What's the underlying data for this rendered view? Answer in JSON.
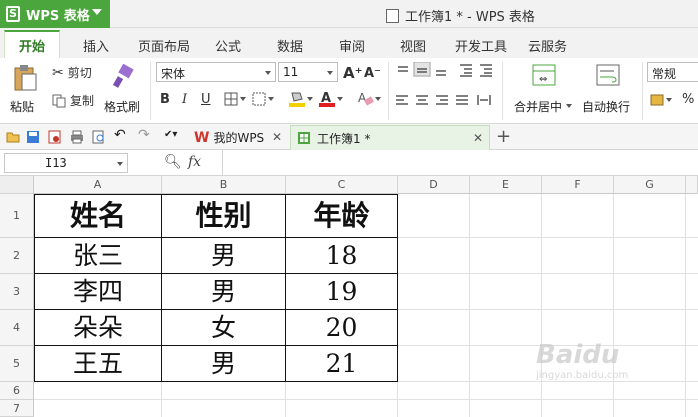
{
  "app": {
    "name": "WPS 表格",
    "logo_letter": "S",
    "window_title": "工作簿1 * - WPS 表格",
    "accent_color": "#4ba63d"
  },
  "menu": {
    "tabs": [
      "开始",
      "插入",
      "页面布局",
      "公式",
      "数据",
      "审阅",
      "视图",
      "开发工具",
      "云服务"
    ],
    "active": "开始"
  },
  "ribbon": {
    "paste": "粘贴",
    "cut": "剪切",
    "copy": "复制",
    "format_painter": "格式刷",
    "font_name": "宋体",
    "font_size": "11",
    "merge_center": "合并居中",
    "wrap_text": "自动换行",
    "number_format": "常规",
    "percent": "%"
  },
  "doc_tabs": {
    "my_wps": "我的WPS",
    "workbook": "工作簿1 *"
  },
  "formula_bar": {
    "cell_ref": "I13",
    "fx": "fx"
  },
  "sheet": {
    "columns": [
      "A",
      "B",
      "C",
      "D",
      "E",
      "F",
      "G"
    ],
    "rows": [
      "1",
      "2",
      "3",
      "4",
      "5",
      "6",
      "7"
    ],
    "table": {
      "headers": [
        "姓名",
        "性别",
        "年龄"
      ],
      "rows": [
        [
          "张三",
          "男",
          "18"
        ],
        [
          "李四",
          "男",
          "19"
        ],
        [
          "朵朵",
          "女",
          "20"
        ],
        [
          "王五",
          "男",
          "21"
        ]
      ]
    }
  },
  "watermark": {
    "text": "Baidu",
    "sub": "jingyan.baidu.com"
  }
}
